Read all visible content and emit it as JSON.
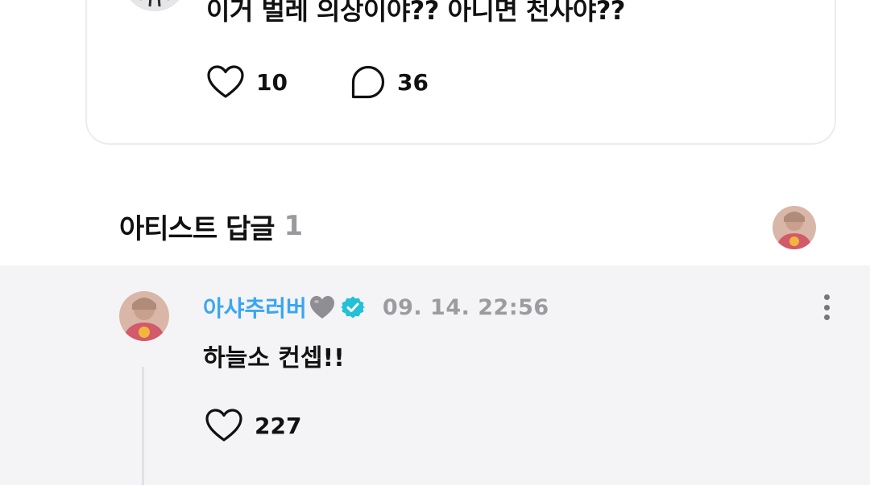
{
  "post": {
    "text": "이거 벌레 의상이야?? 아니면 천사야??",
    "likes": "10",
    "comments": "36"
  },
  "artist_replies": {
    "title": "아티스트 답글",
    "count": "1"
  },
  "reply": {
    "author": "아샤추러버",
    "time": "09. 14. 22:56",
    "text": "하늘소 컨셉!!",
    "likes": "227"
  },
  "colors": {
    "author": "#3aa6f2",
    "verified_badge": "#22c1d6",
    "muted": "#9c9ca0",
    "reply_background": "#f4f4f6"
  },
  "icons": [
    "heart-icon",
    "comment-bubble-icon",
    "grey-heart-emoji-icon",
    "verified-badge-icon",
    "more-vertical-icon"
  ]
}
